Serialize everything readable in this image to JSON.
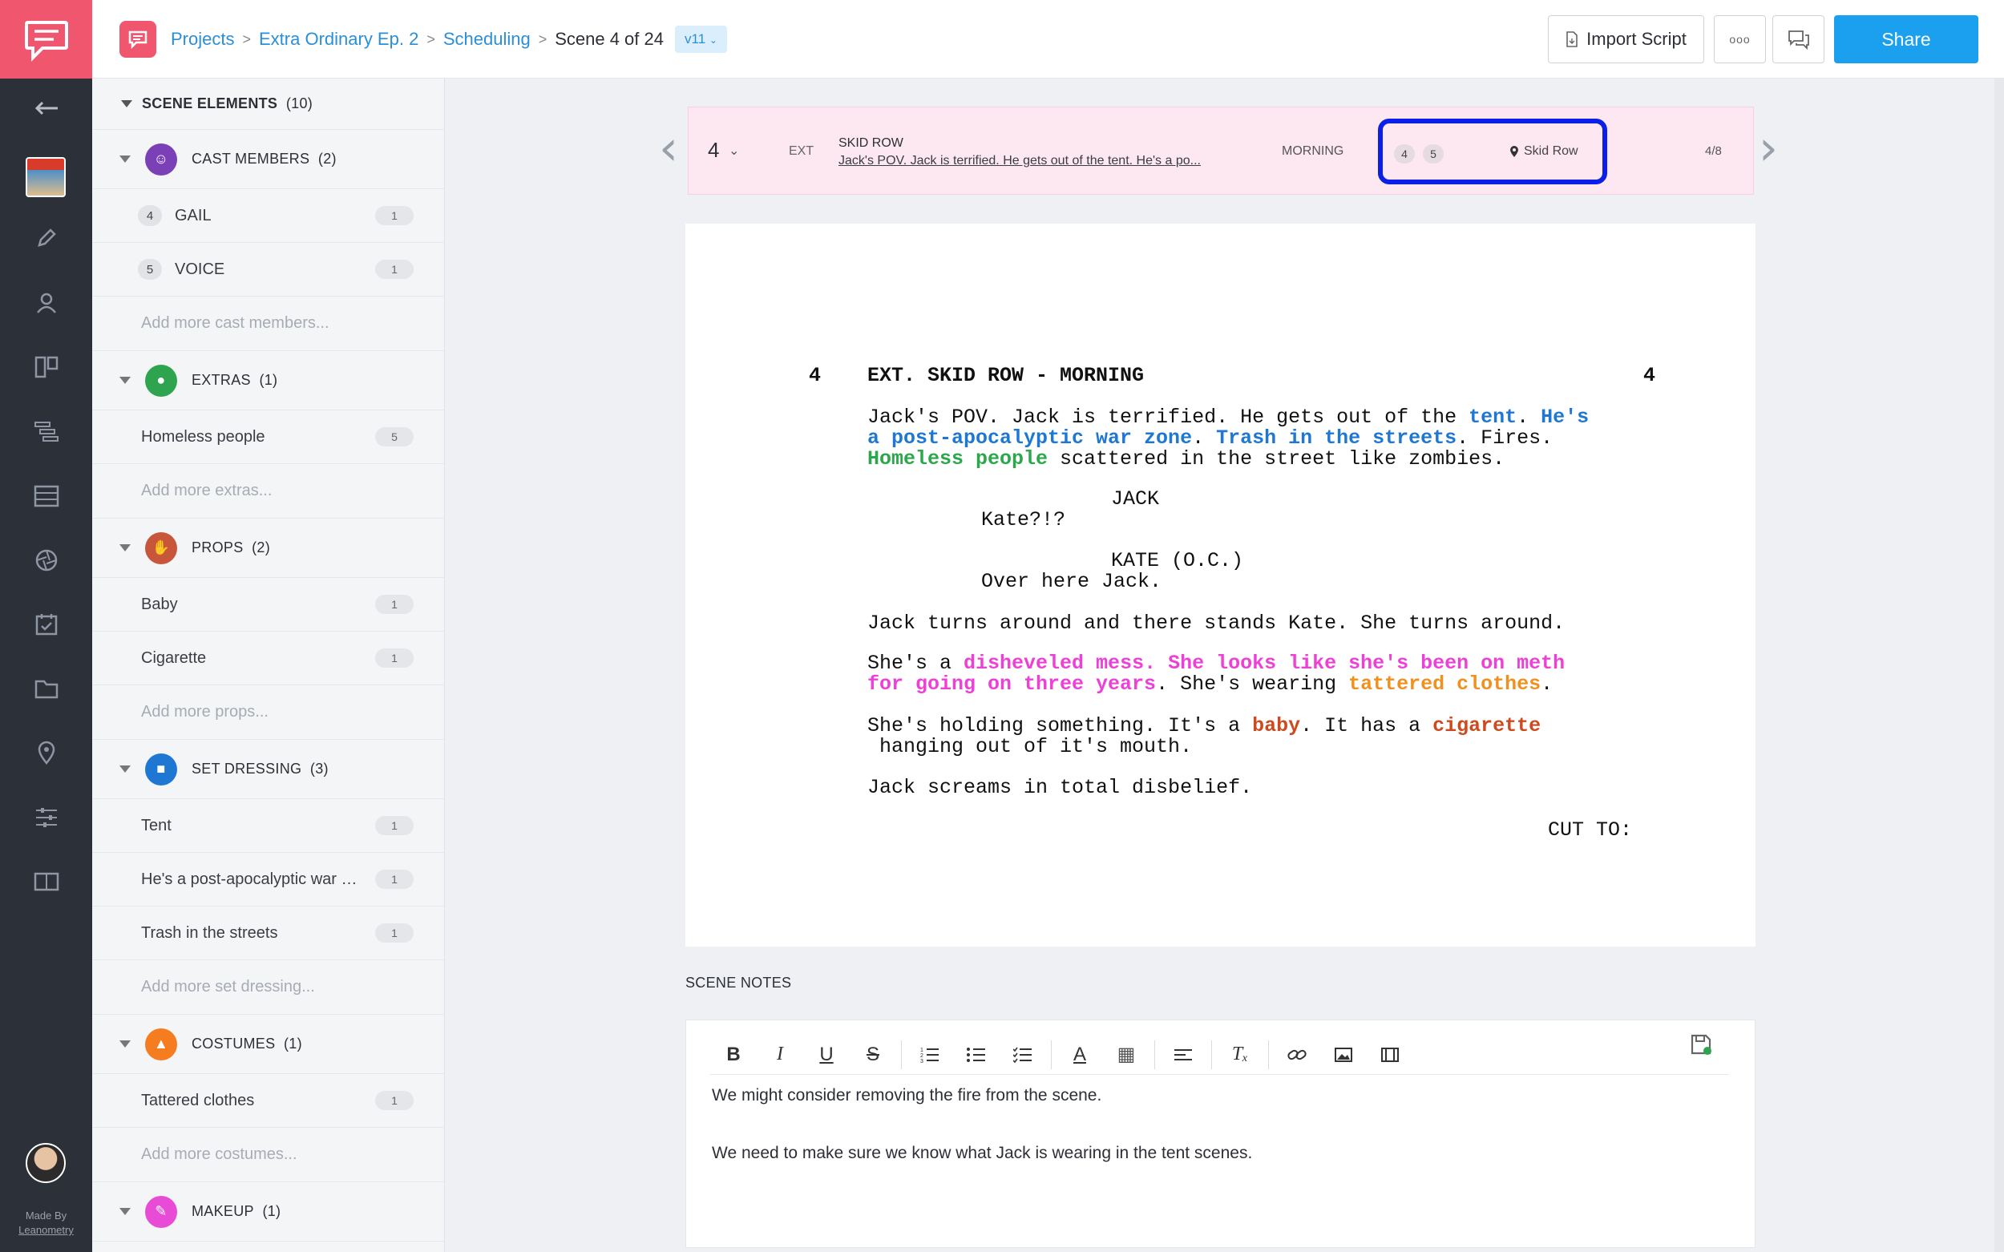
{
  "breadcrumb": {
    "items": [
      "Projects",
      "Extra Ordinary Ep. 2",
      "Scheduling"
    ],
    "current": "Scene 4 of 24",
    "version": "v11"
  },
  "header": {
    "import_label": "Import Script",
    "more_label": "ooo",
    "share_label": "Share"
  },
  "sidebar": {
    "title": "SCENE ELEMENTS",
    "title_count": "(10)",
    "categories": [
      {
        "name": "CAST MEMBERS",
        "count": "(2)",
        "color": "#7b3fb8",
        "items": [
          {
            "num": "4",
            "label": "GAIL",
            "count": "1"
          },
          {
            "num": "5",
            "label": "VOICE",
            "count": "1"
          }
        ],
        "add": "Add more cast members..."
      },
      {
        "name": "EXTRAS",
        "count": "(1)",
        "color": "#2ea44f",
        "items": [
          {
            "label": "Homeless people",
            "count": "5"
          }
        ],
        "add": "Add more extras..."
      },
      {
        "name": "PROPS",
        "count": "(2)",
        "color": "#c8563b",
        "items": [
          {
            "label": "Baby",
            "count": "1"
          },
          {
            "label": "Cigarette",
            "count": "1"
          }
        ],
        "add": "Add more props..."
      },
      {
        "name": "SET DRESSING",
        "count": "(3)",
        "color": "#1e78d3",
        "items": [
          {
            "label": "Tent",
            "count": "1"
          },
          {
            "label": "He's a post-apocalyptic war zone",
            "count": "1"
          },
          {
            "label": "Trash in the streets",
            "count": "1"
          }
        ],
        "add": "Add more set dressing..."
      },
      {
        "name": "COSTUMES",
        "count": "(1)",
        "color": "#f57c1f",
        "items": [
          {
            "label": "Tattered clothes",
            "count": "1"
          }
        ],
        "add": "Add more costumes..."
      },
      {
        "name": "MAKEUP",
        "count": "(1)",
        "color": "#e84bd6",
        "items": [],
        "add": ""
      }
    ]
  },
  "rail": {
    "made_by_1": "Made By",
    "made_by_2": "Leanometry"
  },
  "scene_bar": {
    "number": "4",
    "int_ext": "EXT",
    "title": "SKID ROW",
    "description": "Jack's POV. Jack is terrified. He gets out of the tent. He's a po...",
    "time": "MORNING",
    "cast": [
      "4",
      "5"
    ],
    "location": "Skid Row",
    "page": "4/8"
  },
  "script": {
    "scene_num": "4",
    "heading": "EXT. SKID ROW - MORNING",
    "action1_a": "Jack's POV. Jack is terrified. He gets out of the ",
    "action1_tent": "tent",
    "action1_b": ". ",
    "action1_hes": "He's",
    "action2_war": "a post-apocalyptic war zone",
    "action2_a": ". ",
    "action2_trash": "Trash in the streets",
    "action2_b": ". Fires.",
    "action3_homeless": "Homeless people",
    "action3_a": " scattered in the street like zombies.",
    "char1": "JACK",
    "dial1": "Kate?!?",
    "char2": "KATE (O.C.)",
    "dial2": "Over here Jack.",
    "action4": "Jack turns around and there stands Kate. She turns around.",
    "action5_a": "She's a ",
    "action5_mess": "disheveled mess. She looks like she's been on meth",
    "action6_mess": "for going on three years",
    "action6_a": ". She's wearing ",
    "action6_clothes": "tattered clothes",
    "action6_b": ".",
    "action7_a": "She's holding something. It's a ",
    "action7_baby": "baby",
    "action7_b": ". It has a ",
    "action7_cig": "cigarette",
    "action8": " hanging out of it's mouth.",
    "action9": "Jack screams in total disbelief.",
    "transition": "CUT TO:"
  },
  "notes": {
    "label": "SCENE NOTES",
    "line1": "We might consider removing the fire from the scene.",
    "line2": "We need to make sure we know what Jack is wearing in the tent scenes."
  }
}
